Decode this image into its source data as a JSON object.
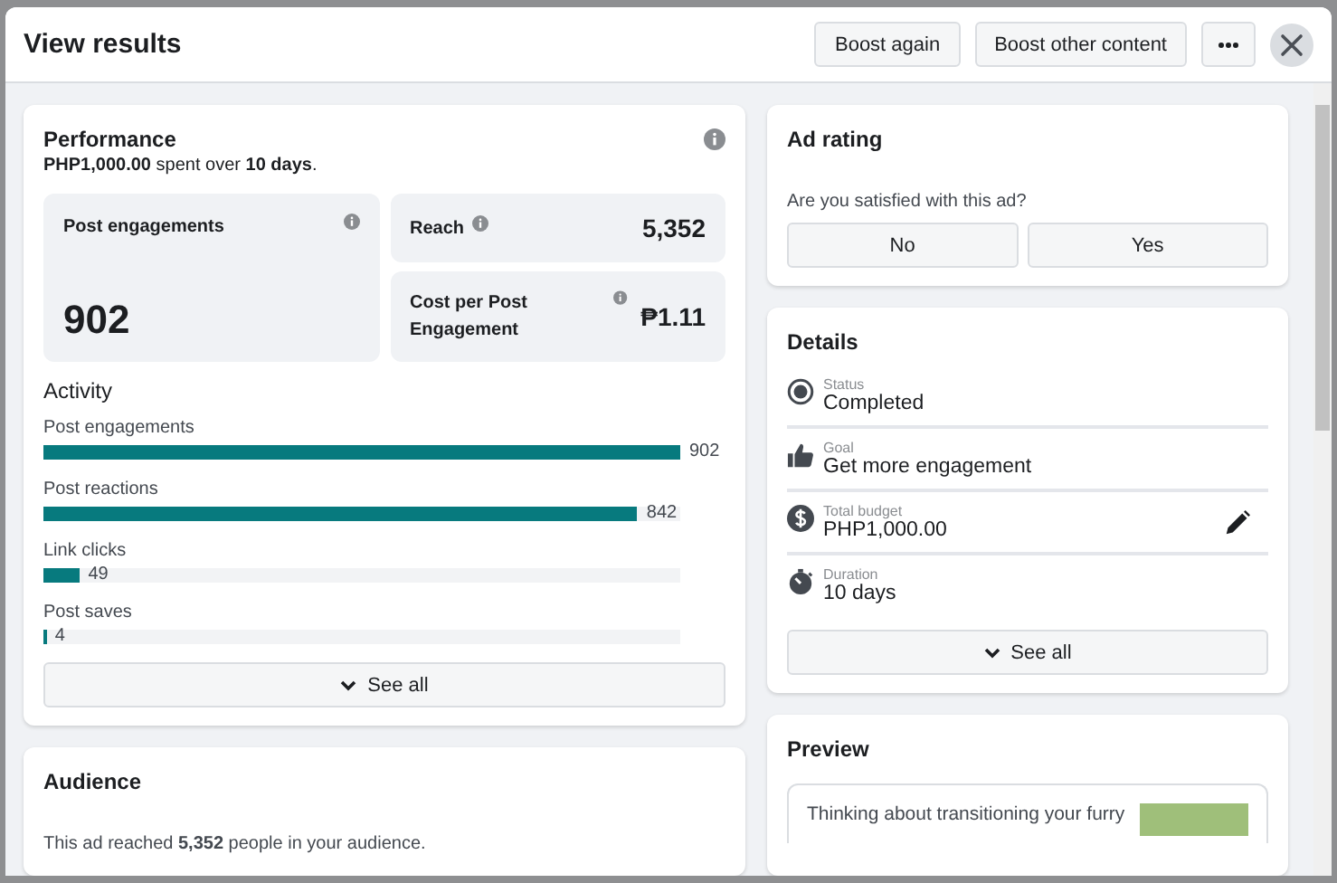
{
  "window": {
    "title": "View results"
  },
  "header_buttons": [
    {
      "label": "Boost again"
    },
    {
      "label": "Boost other content"
    }
  ],
  "performance": {
    "title": "Performance",
    "summary": "**PHP1,000.00** spent over **10 days**.",
    "metrics": [
      {
        "kind": "large",
        "label": "Post engagements",
        "value": "902"
      },
      {
        "kind": "inline",
        "label": "Reach",
        "value": "5,352"
      },
      {
        "kind": "inline",
        "label": "Cost per Post Engagement",
        "value": "₱1.11"
      }
    ],
    "activity": {
      "title": "Activity",
      "items": [
        {
          "label": "Post engagements",
          "value": "902",
          "level": 1
        },
        {
          "label": "Post reactions",
          "value": "842",
          "level": 0.933
        },
        {
          "label": "Link clicks",
          "value": "49",
          "level": 0.056
        },
        {
          "label": "Post saves",
          "value": "4",
          "level": 0.004
        }
      ],
      "see_all": "See all"
    }
  },
  "audience": {
    "title": "Audience",
    "text": "This ad reached **5,352** people in your audience."
  },
  "ad_rating": {
    "title": "Ad rating",
    "question": "Are you satisfied with this ad?",
    "options": [
      "No",
      "Yes"
    ]
  },
  "details": {
    "title": "Details",
    "items": [
      {
        "kind": "status",
        "label": "Status",
        "value": "Completed",
        "editable": false
      },
      {
        "kind": "goal",
        "label": "Goal",
        "value": "Get more engagement",
        "editable": false
      },
      {
        "kind": "budget",
        "label": "Total budget",
        "value": "PHP1,000.00",
        "editable": true
      },
      {
        "kind": "duration",
        "label": "Duration",
        "value": "10 days",
        "editable": false
      }
    ],
    "see_all": "See all"
  },
  "preview": {
    "title": "Preview",
    "text": "Thinking about transitioning your furry"
  }
}
